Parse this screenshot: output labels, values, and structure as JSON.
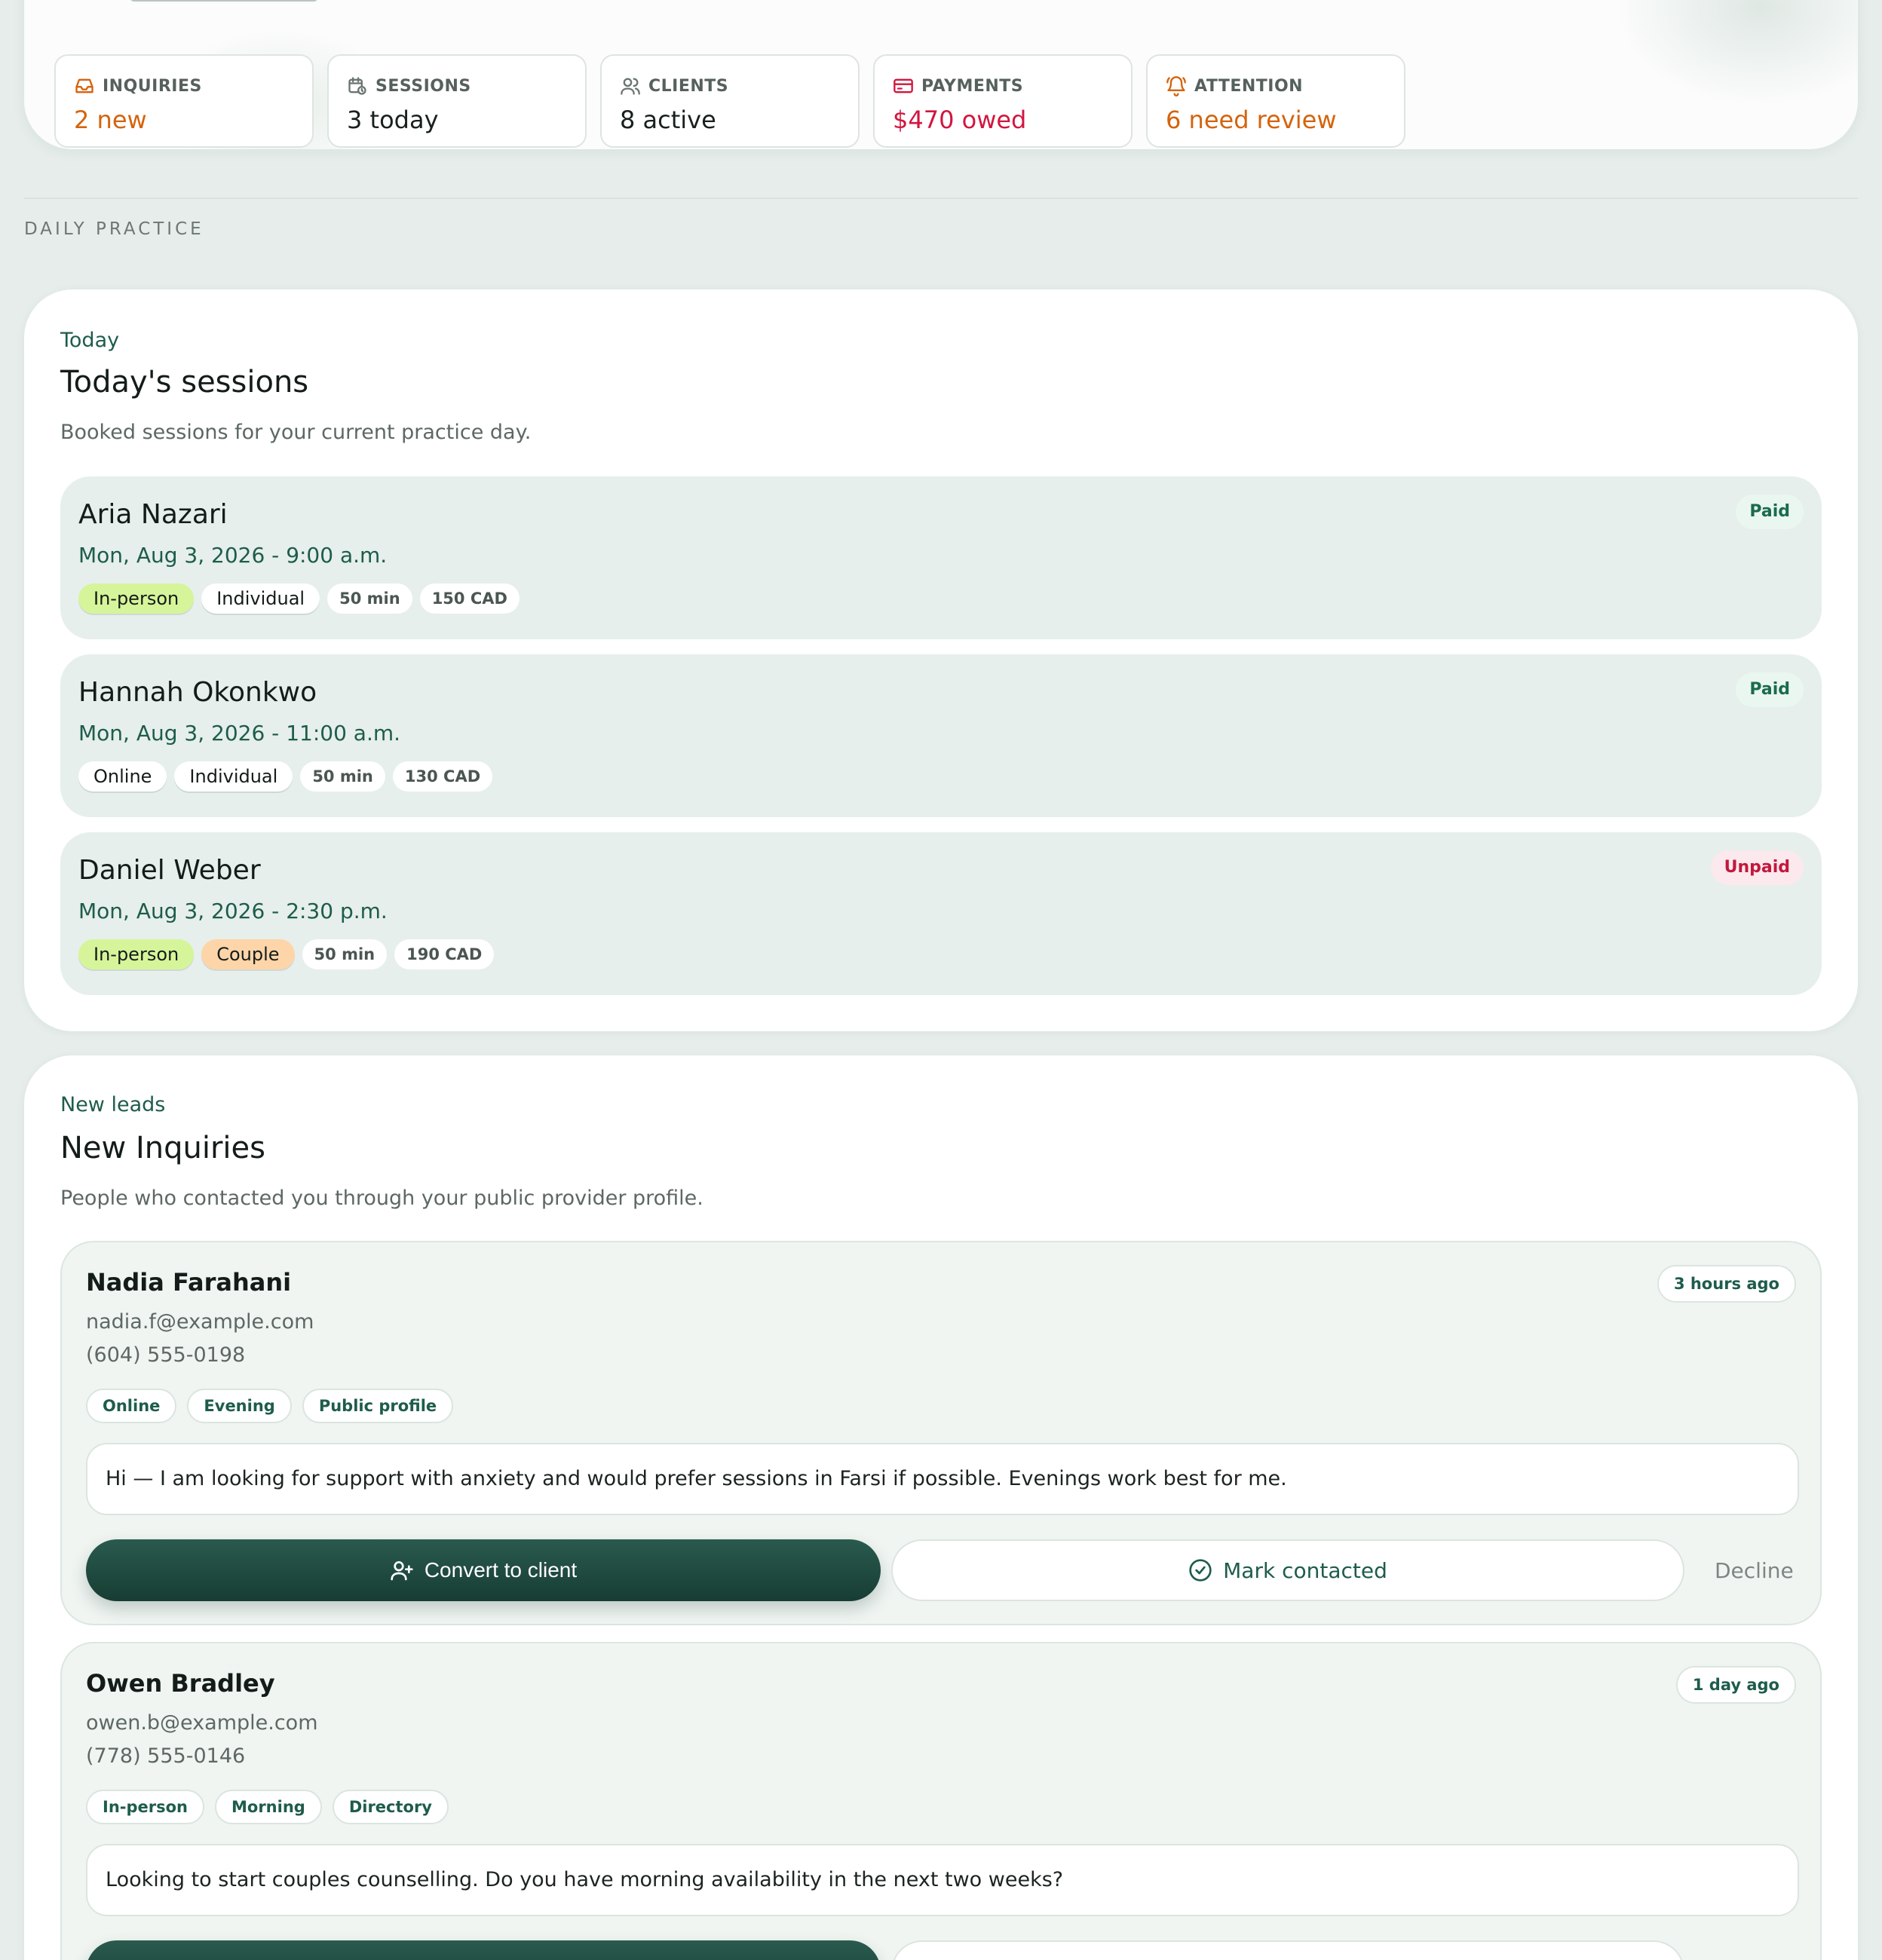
{
  "stats": [
    {
      "label": "INQUIRIES",
      "value": "2 new",
      "icon": "inbox-icon",
      "tone": "orange"
    },
    {
      "label": "SESSIONS",
      "value": "3 today",
      "icon": "calendar-clock-icon",
      "tone": "default"
    },
    {
      "label": "CLIENTS",
      "value": "8 active",
      "icon": "users-icon",
      "tone": "default"
    },
    {
      "label": "PAYMENTS",
      "value": "$470 owed",
      "icon": "credit-card-icon",
      "tone": "red"
    },
    {
      "label": "ATTENTION",
      "value": "6 need review",
      "icon": "bell-ring-icon",
      "tone": "orange"
    }
  ],
  "section_label": "DAILY PRACTICE",
  "sessions_panel": {
    "kicker": "Today",
    "title": "Today's sessions",
    "description": "Booked sessions for your current practice day.",
    "sessions": [
      {
        "name": "Aria Nazari",
        "time": "Mon, Aug 3, 2026 - 9:00 a.m.",
        "mode": "In-person",
        "type": "Individual",
        "duration": "50 min",
        "price": "150 CAD",
        "status": "Paid"
      },
      {
        "name": "Hannah Okonkwo",
        "time": "Mon, Aug 3, 2026 - 11:00 a.m.",
        "mode": "Online",
        "type": "Individual",
        "duration": "50 min",
        "price": "130 CAD",
        "status": "Paid"
      },
      {
        "name": "Daniel Weber",
        "time": "Mon, Aug 3, 2026 - 2:30 p.m.",
        "mode": "In-person",
        "type": "Couple",
        "duration": "50 min",
        "price": "190 CAD",
        "status": "Unpaid"
      }
    ]
  },
  "inquiries_panel": {
    "kicker": "New leads",
    "title": "New Inquiries",
    "description": "People who contacted you through your public provider profile.",
    "inquiries": [
      {
        "name": "Nadia Farahani",
        "email": "nadia.f@example.com",
        "phone": "(604) 555-0198",
        "age": "3 hours ago",
        "tags": [
          "Online",
          "Evening",
          "Public profile"
        ],
        "message": "Hi — I am looking for support with anxiety and would prefer sessions in Farsi if possible. Evenings work best for me."
      },
      {
        "name": "Owen Bradley",
        "email": "owen.b@example.com",
        "phone": "(778) 555-0146",
        "age": "1 day ago",
        "tags": [
          "In-person",
          "Morning",
          "Directory"
        ],
        "message": "Looking to start couples counselling. Do you have morning availability in the next two weeks?"
      }
    ],
    "actions": {
      "convert": "Convert to client",
      "contacted": "Mark contacted",
      "decline": "Decline"
    }
  },
  "colors": {
    "accent": "#1e5c4c",
    "primary_button": "#1f4a3f",
    "orange": "#d4640d",
    "red": "#d2163f"
  }
}
